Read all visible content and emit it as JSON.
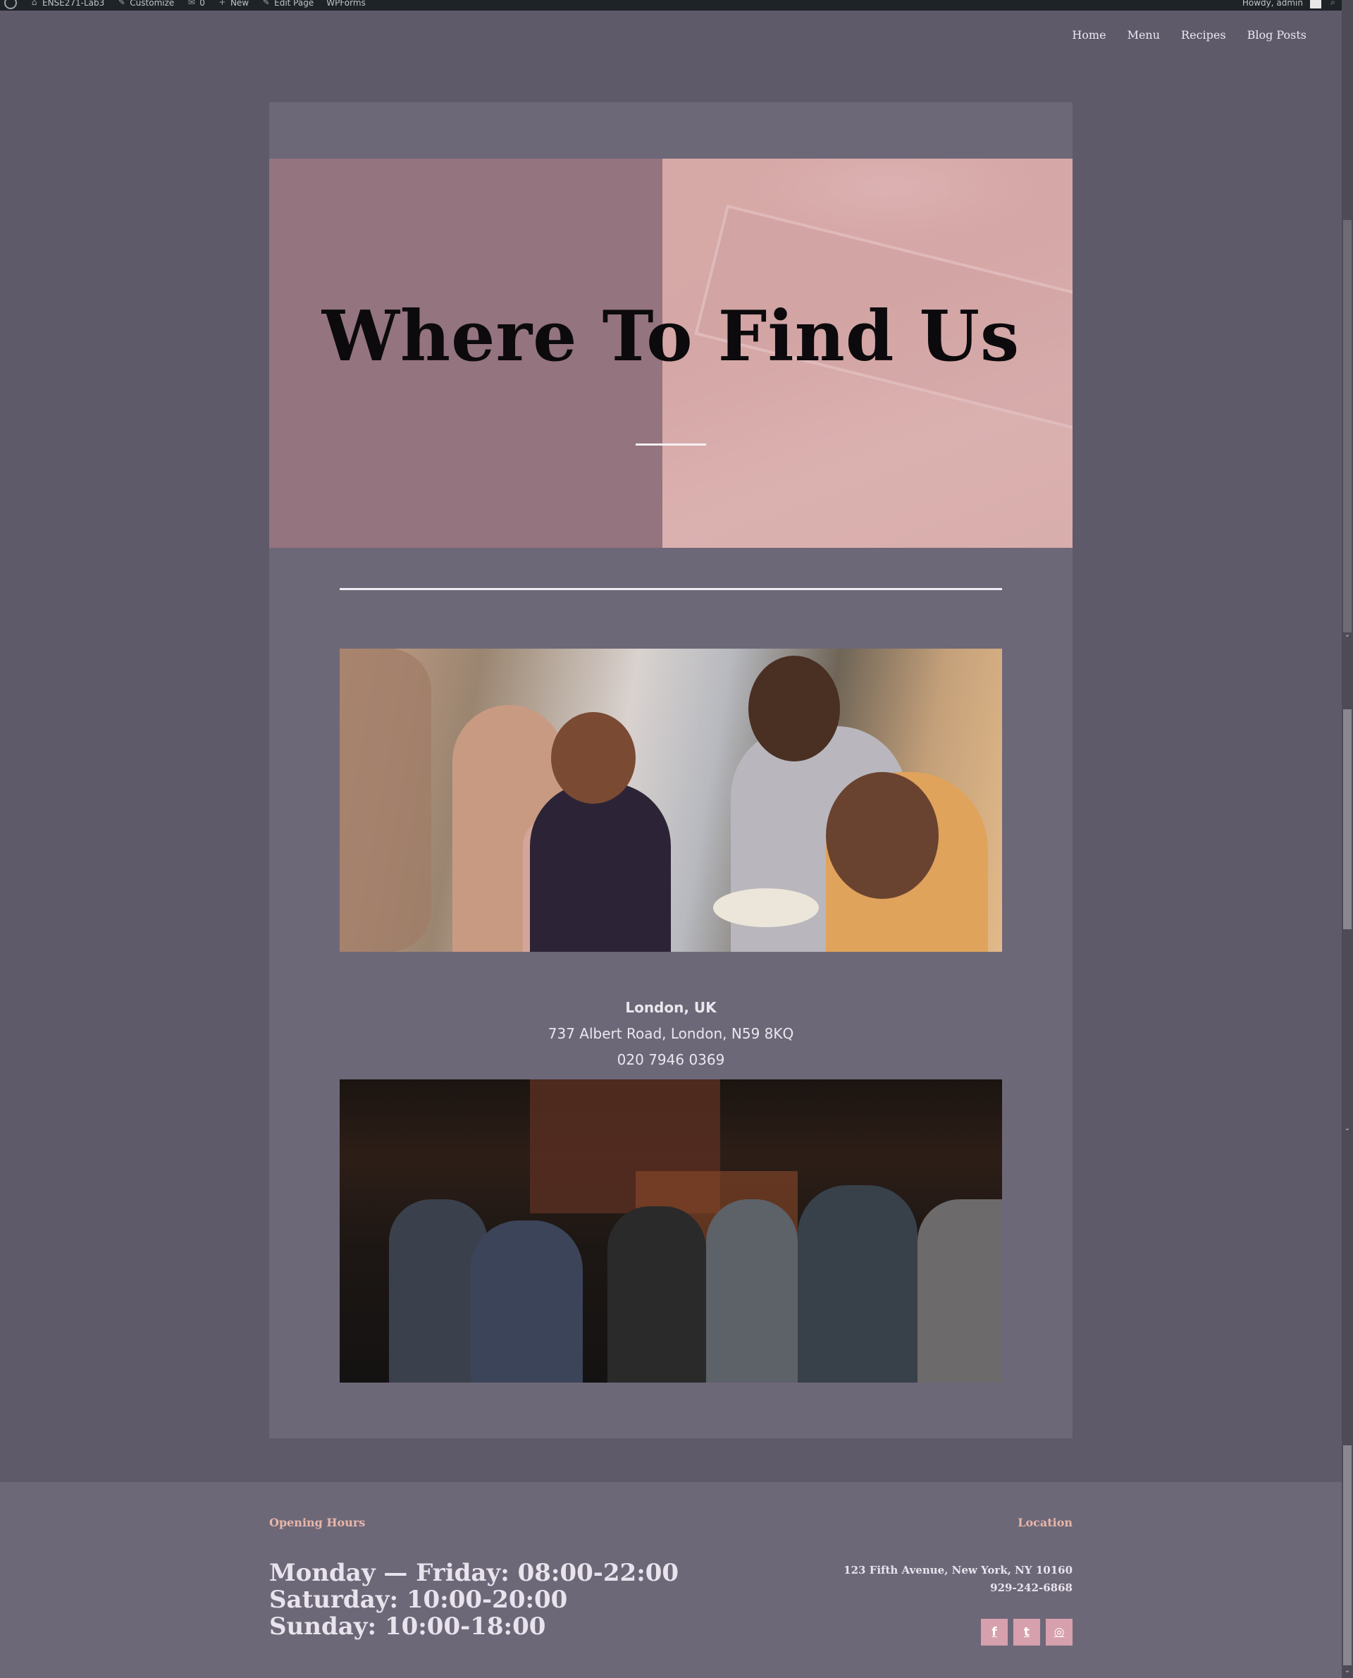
{
  "admin_bar": {
    "site_name": "ENSE271-Lab3",
    "customize": "Customize",
    "comments_count": "0",
    "new": "New",
    "edit_page": "Edit Page",
    "wpforms": "WPForms",
    "howdy": "Howdy, admin"
  },
  "nav": {
    "items": [
      "Home",
      "Menu",
      "Recipes",
      "Blog Posts"
    ]
  },
  "hero": {
    "title": "Where To Find Us"
  },
  "location": {
    "name": "London, UK",
    "address": "737 Albert Road, London, N59 8KQ",
    "phone": "020 7946 0369"
  },
  "footer": {
    "hours_heading": "Opening Hours",
    "hours": [
      "Monday — Friday: 08:00-22:00",
      "Saturday: 10:00-20:00",
      "Sunday: 10:00-18:00"
    ],
    "location_heading": "Location",
    "address": "123 Fifth Avenue, New York, NY 10160",
    "phone": "929-242-6868",
    "socials": [
      "facebook-icon",
      "twitter-icon",
      "instagram-icon"
    ]
  },
  "colors": {
    "page_bg": "#5e5a69",
    "card_bg": "#6d6878",
    "accent": "#e9b6a9",
    "social_bg": "#d6a0ad"
  }
}
